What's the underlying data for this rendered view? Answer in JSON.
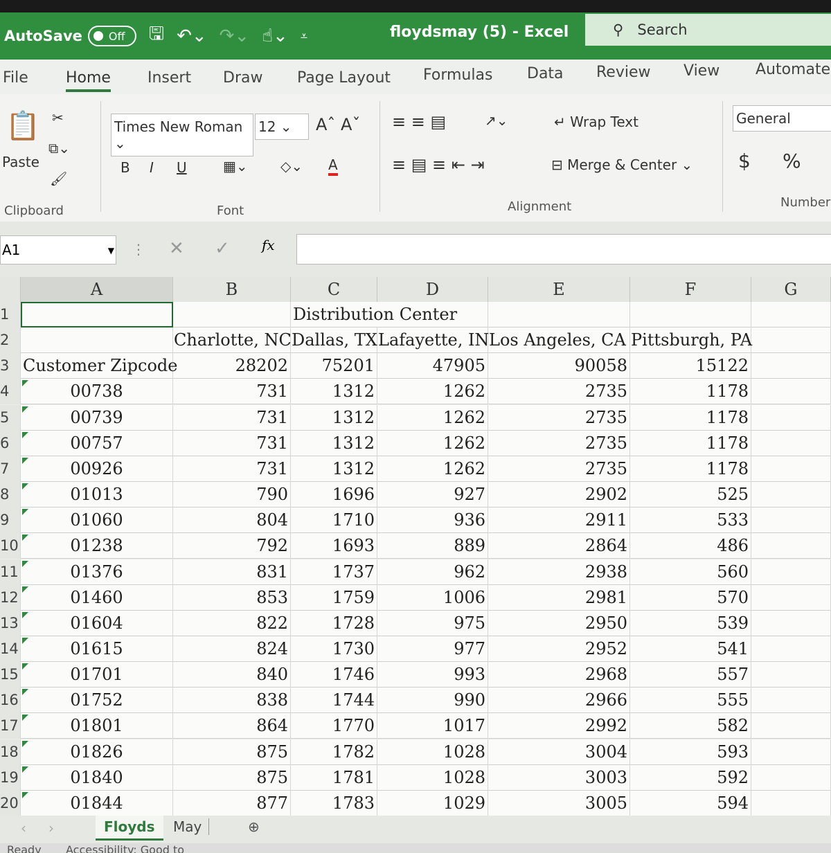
{
  "titlebar": {
    "autosave": "AutoSave",
    "toggle": "Off",
    "title": "floydsmay (5)  -  Excel",
    "search": "Search"
  },
  "tabs": [
    "File",
    "Home",
    "Insert",
    "Draw",
    "Page Layout",
    "Formulas",
    "Data",
    "Review",
    "View",
    "Automate"
  ],
  "ribbon": {
    "paste": "Paste",
    "font_name": "Times New Roman",
    "font_size": "12",
    "bold": "B",
    "italic": "I",
    "underline": "U",
    "wrap_text": "Wrap Text",
    "merge_center": "Merge & Center",
    "number_format": "General",
    "currency": "$",
    "percent": "%",
    "groups": {
      "clipboard": "Clipboard",
      "font": "Font",
      "alignment": "Alignment",
      "number": "Number"
    }
  },
  "formula_bar": {
    "name_box": "A1",
    "fx": "fx",
    "value": ""
  },
  "columns": [
    "A",
    "B",
    "C",
    "D",
    "E",
    "F",
    "G"
  ],
  "rows": [
    [
      "1",
      "",
      "",
      "Distribution Center",
      "",
      "",
      "",
      ""
    ],
    [
      "2",
      "",
      "Charlotte, NC",
      "Dallas, TX",
      "Lafayette, IN",
      "Los Angeles, CA",
      "Pittsburgh, PA",
      ""
    ],
    [
      "3",
      "Customer Zipcode",
      "28202",
      "75201",
      "47905",
      "90058",
      "15122",
      ""
    ],
    [
      "4",
      "00738",
      "731",
      "1312",
      "1262",
      "2735",
      "1178",
      ""
    ],
    [
      "5",
      "00739",
      "731",
      "1312",
      "1262",
      "2735",
      "1178",
      ""
    ],
    [
      "6",
      "00757",
      "731",
      "1312",
      "1262",
      "2735",
      "1178",
      ""
    ],
    [
      "7",
      "00926",
      "731",
      "1312",
      "1262",
      "2735",
      "1178",
      ""
    ],
    [
      "8",
      "01013",
      "790",
      "1696",
      "927",
      "2902",
      "525",
      ""
    ],
    [
      "9",
      "01060",
      "804",
      "1710",
      "936",
      "2911",
      "533",
      ""
    ],
    [
      "10",
      "01238",
      "792",
      "1693",
      "889",
      "2864",
      "486",
      ""
    ],
    [
      "11",
      "01376",
      "831",
      "1737",
      "962",
      "2938",
      "560",
      ""
    ],
    [
      "12",
      "01460",
      "853",
      "1759",
      "1006",
      "2981",
      "570",
      ""
    ],
    [
      "13",
      "01604",
      "822",
      "1728",
      "975",
      "2950",
      "539",
      ""
    ],
    [
      "14",
      "01615",
      "824",
      "1730",
      "977",
      "2952",
      "541",
      ""
    ],
    [
      "15",
      "01701",
      "840",
      "1746",
      "993",
      "2968",
      "557",
      ""
    ],
    [
      "16",
      "01752",
      "838",
      "1744",
      "990",
      "2966",
      "555",
      ""
    ],
    [
      "17",
      "01801",
      "864",
      "1770",
      "1017",
      "2992",
      "582",
      ""
    ],
    [
      "18",
      "01826",
      "875",
      "1782",
      "1028",
      "3004",
      "593",
      ""
    ],
    [
      "19",
      "01840",
      "875",
      "1781",
      "1028",
      "3003",
      "592",
      ""
    ],
    [
      "20",
      "01844",
      "877",
      "1783",
      "1029",
      "3005",
      "594",
      ""
    ]
  ],
  "sheets": [
    {
      "label": "Floyds",
      "active": true
    },
    {
      "label": "May",
      "active": false
    }
  ],
  "status": {
    "ready": "Ready",
    "accessibility": "Accessibility: Good to"
  },
  "colors": {
    "accent": "#2f8f3e"
  }
}
